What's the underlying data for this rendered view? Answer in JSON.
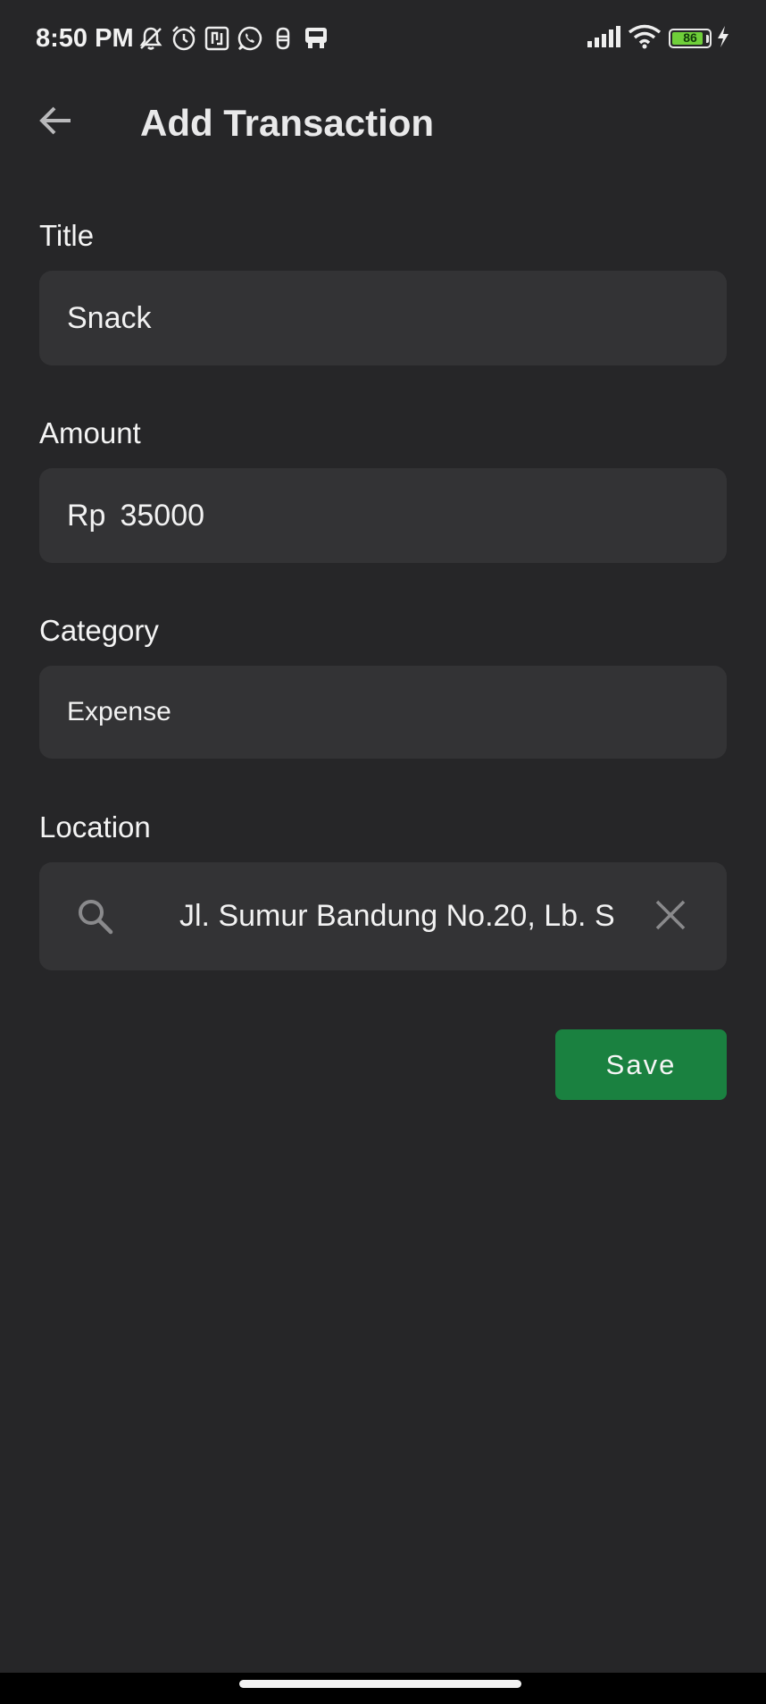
{
  "status_bar": {
    "time": "8:50 PM",
    "battery_level": "86",
    "battery_fraction": 0.86,
    "icons_left": [
      "mute-bell-icon",
      "alarm-icon",
      "nfc-icon",
      "whatsapp-icon",
      "app-notification-icon",
      "bus-notification-icon"
    ],
    "icons_right": [
      "signal-icon",
      "wifi-icon",
      "battery-icon",
      "charging-icon"
    ],
    "battery_color": "#6fcf3a"
  },
  "app_bar": {
    "title": "Add Transaction",
    "back_icon": "arrow-left-icon"
  },
  "form": {
    "title": {
      "label": "Title",
      "value": "Snack"
    },
    "amount": {
      "label": "Amount",
      "prefix": "Rp",
      "value": "35000"
    },
    "category": {
      "label": "Category",
      "value": "Expense"
    },
    "location": {
      "label": "Location",
      "value": "Jl. Sumur Bandung No.20, Lb. S",
      "search_icon": "search-icon",
      "clear_icon": "close-icon"
    },
    "save_label": "Save"
  },
  "colors": {
    "background": "#262628",
    "field_background": "#333335",
    "save_button": "#1a8140",
    "text": "#f2f2f2"
  }
}
